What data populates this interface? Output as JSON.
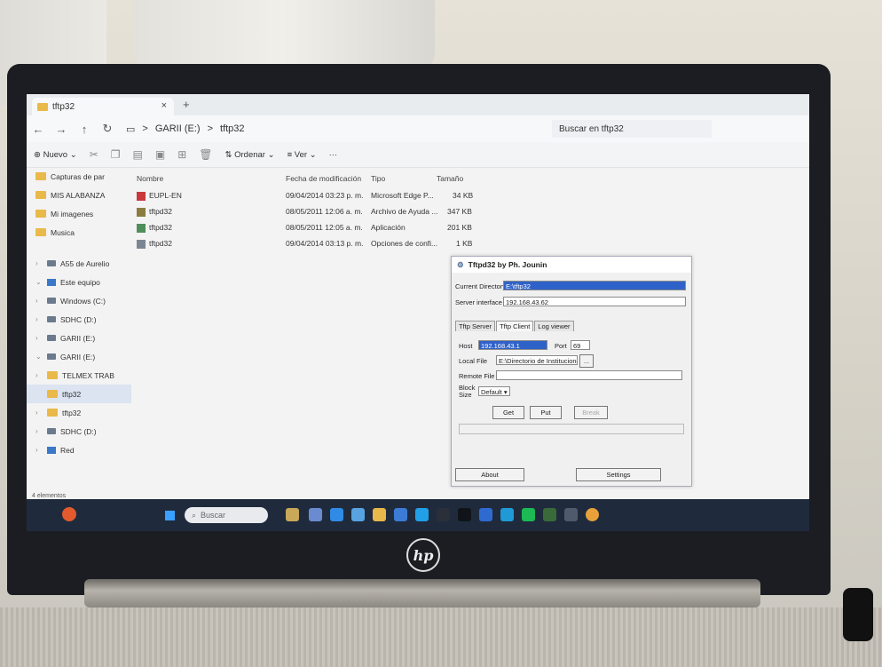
{
  "tab": {
    "title": "tftp32",
    "close": "×",
    "new": "+"
  },
  "address": {
    "drive": "GARII (E:)",
    "folder": "tftp32",
    "sep": ">",
    "search_placeholder": "Buscar en tftp32"
  },
  "toolbar": {
    "new": "Nuevo",
    "sort": "Ordenar",
    "view": "Ver",
    "more": "···"
  },
  "sidebar": {
    "items": [
      {
        "label": "Capturas de par",
        "icon": "folder-icon"
      },
      {
        "label": "MIS ALABANZA",
        "icon": "folder-icon"
      },
      {
        "label": "Mi imagenes",
        "icon": "folder-icon"
      },
      {
        "label": "Musica",
        "icon": "folder-icon"
      },
      {
        "label": "A55 de Aurelio",
        "icon": "phone-icon"
      },
      {
        "label": "Este equipo",
        "icon": "pc-icon"
      },
      {
        "label": "Windows (C:)",
        "icon": "drive-icon"
      },
      {
        "label": "SDHC (D:)",
        "icon": "drive-icon"
      },
      {
        "label": "GARII (E:)",
        "icon": "drive-icon"
      },
      {
        "label": "GARII (E:)",
        "icon": "drive-icon"
      },
      {
        "label": "TELMEX TRAB",
        "icon": "folder-icon"
      },
      {
        "label": "tftp32",
        "icon": "folder-icon"
      },
      {
        "label": "tftp32",
        "icon": "folder-icon"
      },
      {
        "label": "SDHC (D:)",
        "icon": "drive-icon"
      },
      {
        "label": "Red",
        "icon": "network-icon"
      }
    ],
    "status": "4 elementos"
  },
  "files": {
    "headers": {
      "name": "Nombre",
      "date": "Fecha de modificación",
      "type": "Tipo",
      "size": "Tamaño"
    },
    "rows": [
      {
        "name": "EUPL-EN",
        "date": "09/04/2014 03:23 p. m.",
        "type": "Microsoft Edge P...",
        "size": "34 KB",
        "color": "#c8373b"
      },
      {
        "name": "tftpd32",
        "date": "08/05/2011 12:06 a. m.",
        "type": "Archivo de Ayuda ...",
        "size": "347 KB",
        "color": "#8a7c3f"
      },
      {
        "name": "tftpd32",
        "date": "08/05/2011 12:05 a. m.",
        "type": "Aplicación",
        "size": "201 KB",
        "color": "#4f8e5a"
      },
      {
        "name": "tftpd32",
        "date": "09/04/2014 03:13 p. m.",
        "type": "Opciones de confi...",
        "size": "1 KB",
        "color": "#7a8693"
      }
    ]
  },
  "dialog": {
    "title": "Tftpd32 by Ph. Jounin",
    "current_dir_label": "Current Directory",
    "current_dir_value": "E:\\tftp32",
    "server_iface_label": "Server interface",
    "server_iface_value": "192.168.43.62",
    "tabs": [
      "Tftp Server",
      "Tftp Client",
      "Log viewer"
    ],
    "host_label": "Host",
    "host_value": "192.168.43.1",
    "port_label": "Port",
    "port_value": "69",
    "local_file_label": "Local File",
    "local_file_value": "E:\\Directorio de Instituciones",
    "local_file_btn": "...",
    "remote_file_label": "Remote File",
    "block_size_label": "Block Size",
    "block_size_value": "Default",
    "get": "Get",
    "put": "Put",
    "break": "Break",
    "about": "About",
    "settings": "Settings"
  },
  "taskbar": {
    "search": "Buscar"
  },
  "hp_logo": "hp"
}
